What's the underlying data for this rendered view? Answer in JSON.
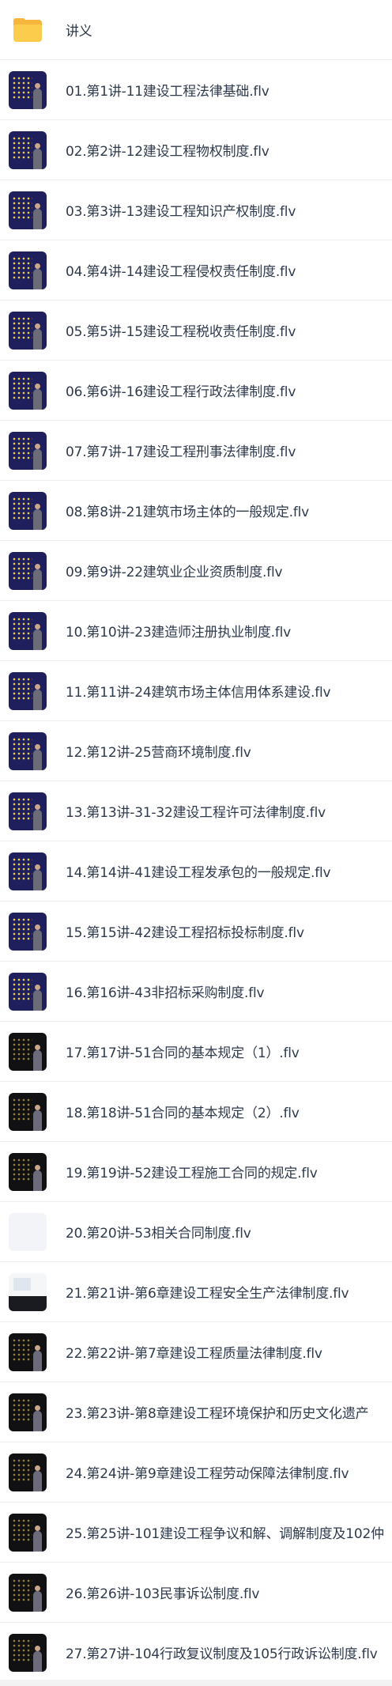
{
  "folder": {
    "name": "讲义",
    "icon": "folder-icon"
  },
  "files": [
    {
      "name": "01.第1讲-11建设工程法律基础.flv",
      "thumb": "navy"
    },
    {
      "name": "02.第2讲-12建设工程物权制度.flv",
      "thumb": "navy"
    },
    {
      "name": "03.第3讲-13建设工程知识产权制度.flv",
      "thumb": "navy"
    },
    {
      "name": "04.第4讲-14建设工程侵权责任制度.flv",
      "thumb": "navy"
    },
    {
      "name": "05.第5讲-15建设工程税收责任制度.flv",
      "thumb": "navy"
    },
    {
      "name": "06.第6讲-16建设工程行政法律制度.flv",
      "thumb": "navy"
    },
    {
      "name": "07.第7讲-17建设工程刑事法律制度.flv",
      "thumb": "navy"
    },
    {
      "name": "08.第8讲-21建筑市场主体的一般规定.flv",
      "thumb": "navy"
    },
    {
      "name": "09.第9讲-22建筑业企业资质制度.flv",
      "thumb": "navy"
    },
    {
      "name": "10.第10讲-23建造师注册执业制度.flv",
      "thumb": "navy"
    },
    {
      "name": "11.第11讲-24建筑市场主体信用体系建设.flv",
      "thumb": "navy"
    },
    {
      "name": "12.第12讲-25营商环境制度.flv",
      "thumb": "navy"
    },
    {
      "name": "13.第13讲-31-32建设工程许可法律制度.flv",
      "thumb": "navy"
    },
    {
      "name": "14.第14讲-41建设工程发承包的一般规定.flv",
      "thumb": "navy"
    },
    {
      "name": "15.第15讲-42建设工程招标投标制度.flv",
      "thumb": "navy"
    },
    {
      "name": "16.第16讲-43非招标采购制度.flv",
      "thumb": "navy"
    },
    {
      "name": "17.第17讲-51合同的基本规定（1）.flv",
      "thumb": "dark"
    },
    {
      "name": "18.第18讲-51合同的基本规定（2）.flv",
      "thumb": "dark"
    },
    {
      "name": "19.第19讲-52建设工程施工合同的规定.flv",
      "thumb": "dark"
    },
    {
      "name": "20.第20讲-53相关合同制度.flv",
      "thumb": "light"
    },
    {
      "name": "21.第21讲-第6章建设工程安全生产法律制度.flv",
      "thumb": "half"
    },
    {
      "name": "22.第22讲-第7章建设工程质量法律制度.flv",
      "thumb": "dark"
    },
    {
      "name": "23.第23讲-第8章建设工程环境保护和历史文化遗产",
      "thumb": "dark"
    },
    {
      "name": "24.第24讲-第9章建设工程劳动保障法律制度.flv",
      "thumb": "dark"
    },
    {
      "name": "25.第25讲-101建设工程争议和解、调解制度及102仲",
      "thumb": "dark"
    },
    {
      "name": "26.第26讲-103民事诉讼制度.flv",
      "thumb": "dark"
    },
    {
      "name": "27.第27讲-104行政复议制度及105行政诉讼制度.flv",
      "thumb": "dark"
    }
  ]
}
